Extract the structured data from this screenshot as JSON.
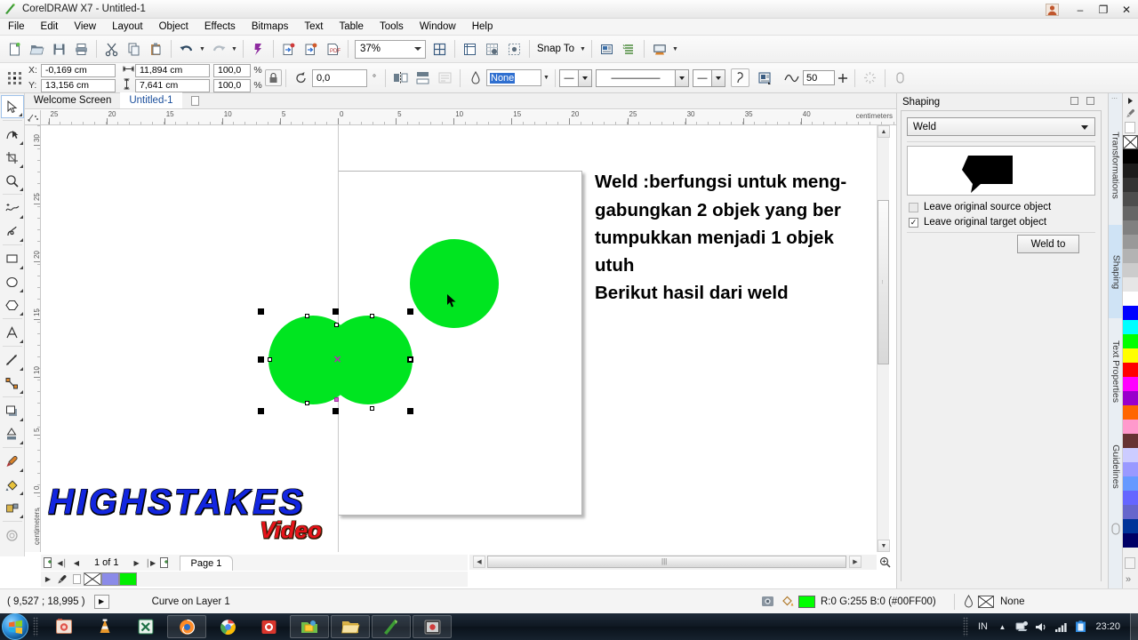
{
  "window": {
    "title": "CorelDRAW X7 - Untitled-1",
    "app_icon": "coreldraw-icon",
    "minimize": "–",
    "maximize": "❐",
    "close": "✕"
  },
  "menubar": {
    "items": [
      {
        "label": "File"
      },
      {
        "label": "Edit"
      },
      {
        "label": "View"
      },
      {
        "label": "Layout"
      },
      {
        "label": "Object"
      },
      {
        "label": "Effects"
      },
      {
        "label": "Bitmaps"
      },
      {
        "label": "Text"
      },
      {
        "label": "Table"
      },
      {
        "label": "Tools"
      },
      {
        "label": "Window"
      },
      {
        "label": "Help"
      }
    ]
  },
  "standard_toolbar": {
    "buttons": [
      "new-document-icon",
      "open-document-icon",
      "save-icon",
      "print-icon",
      "cut-icon",
      "copy-icon",
      "paste-icon",
      "undo-icon",
      "redo-icon",
      "import-icon",
      "export-icon",
      "publish-pdf-icon",
      "corel-connect-icon"
    ],
    "zoom_level": "37%",
    "snap_to_label": "Snap To",
    "options_icon": "options-icon",
    "view_icons": [
      "full-screen-preview-icon",
      "show-hide-rulers-icon",
      "show-hide-grid-icon",
      "show-hide-guidelines-icon"
    ]
  },
  "property_bar": {
    "x_label": "X:",
    "x_value": "-0,169 cm",
    "y_label": "Y:",
    "y_value": "13,156 cm",
    "width_value": "11,894 cm",
    "height_value": "7,641 cm",
    "scale_h": "100,0",
    "scale_v": "100,0",
    "percent_sign": "%",
    "lock_ratio_icon": "lock-ratio-icon",
    "rotation_value": "0,0",
    "degree_sign": "°",
    "mirror_icons": [
      "mirror-horizontal-icon",
      "mirror-vertical-icon",
      "wrap-paragraph-text-icon"
    ],
    "outline_width": "None",
    "outline_style_label": "",
    "arrow_start": "—",
    "line_style": "—————",
    "arrow_end": "—",
    "outline_pen_icon": "outline-pen-icon",
    "text_wrap_icon": "text-wrap-icon",
    "corner_smooth_icon": "corner-smooth-icon",
    "corner_value": "50",
    "edit_icon": "edit-bitmap-icon",
    "group_icon": "convert-outline-icon"
  },
  "doc_tabs": {
    "items": [
      {
        "label": "Welcome Screen",
        "active": false
      },
      {
        "label": "Untitled-1",
        "active": true
      }
    ],
    "new_tab_icon": "new-tab-icon"
  },
  "toolbox": {
    "tools": [
      {
        "name": "pick-tool",
        "selected": true
      },
      {
        "name": "shape-tool",
        "selected": false
      },
      {
        "name": "crop-tool",
        "selected": false
      },
      {
        "name": "zoom-tool",
        "selected": false
      },
      {
        "name": "freehand-tool",
        "selected": false
      },
      {
        "name": "smart-fill-tool",
        "selected": false
      },
      {
        "name": "rectangle-tool",
        "selected": false
      },
      {
        "name": "ellipse-tool",
        "selected": false
      },
      {
        "name": "polygon-tool",
        "selected": false
      },
      {
        "name": "text-tool",
        "selected": false
      },
      {
        "name": "parallel-dimension-tool",
        "selected": false
      },
      {
        "name": "straight-line-connector-tool",
        "selected": false
      },
      {
        "name": "drop-shadow-tool",
        "selected": false
      },
      {
        "name": "transparency-tool",
        "selected": false
      },
      {
        "name": "color-eyedropper-tool",
        "selected": false
      },
      {
        "name": "fill-tool",
        "selected": false
      },
      {
        "name": "interactive-fill-tool",
        "selected": false
      },
      {
        "name": "outline-tool",
        "selected": false
      }
    ]
  },
  "rulers": {
    "unit_label": "centimeters",
    "h_ticks": [
      "25",
      "20",
      "15",
      "10",
      "5",
      "0",
      "5",
      "10",
      "15",
      "20",
      "25",
      "30",
      "35",
      "40"
    ],
    "v_ticks": [
      "30",
      "25",
      "20",
      "15",
      "10",
      "5",
      "0"
    ]
  },
  "canvas": {
    "annotation_lines": [
      "Weld :berfungsi untuk meng-",
      "gabungkan 2 objek yang ber",
      "tumpukkan menjadi 1 objek",
      "utuh",
      "Berikut hasil dari weld"
    ],
    "shape_color": "#00e520",
    "shapes": [
      {
        "name": "welded-circles-object"
      },
      {
        "name": "source-circle-object"
      }
    ],
    "watermark_main": "HIGHSTAKES",
    "watermark_sub": "Video",
    "watermark_main_color": "#1226e0",
    "watermark_sub_color": "#e8131a"
  },
  "page_nav": {
    "add_page_start_icon": "add-page-icon",
    "first_icon": "◀│",
    "prev_icon": "◀",
    "page_counter": "1 of 1",
    "next_icon": "▶",
    "last_icon": "│▶",
    "add_page_end_icon": "add-page-icon",
    "page_tab": "Page 1"
  },
  "status_bar": {
    "coordinates": "( 9,527 ; 18,995 )",
    "object_info": "Curve on Layer 1",
    "fill_icon": "fill-color-icon",
    "fill_value": "R:0 G:255 B:0 (#00FF00)",
    "fill_swatch": "#00FF00",
    "outline_icon": "outline-color-icon",
    "outline_value": "None"
  },
  "docker": {
    "title": "Shaping",
    "minimize_icon": "docker-minimize-icon",
    "close_icon": "docker-close-icon",
    "operation": "Weld",
    "preview_icon": "weld-result-preview",
    "checkbox_source": {
      "label": "Leave original source object",
      "checked": false
    },
    "checkbox_target": {
      "label": "Leave original target object",
      "checked": true
    },
    "action_button": "Weld to",
    "tabs": [
      {
        "label": "Transformations",
        "selected": false,
        "icon": "transformations-icon"
      },
      {
        "label": "Shaping",
        "selected": true,
        "icon": "shaping-icon"
      },
      {
        "label": "Text Properties",
        "selected": false,
        "icon": "text-properties-icon"
      },
      {
        "label": "Guidelines",
        "selected": false,
        "icon": "guidelines-icon"
      },
      {
        "label": "",
        "selected": false,
        "icon": "object-properties-icon"
      }
    ]
  },
  "palette": {
    "no_color_label": "no-color-swatch",
    "colors": [
      "#000000",
      "#1c1c1c",
      "#333333",
      "#4d4d4d",
      "#666666",
      "#808080",
      "#999999",
      "#b3b3b3",
      "#cccccc",
      "#e6e6e6",
      "#ffffff",
      "#0000ff",
      "#00ffff",
      "#00ff00",
      "#ffff00",
      "#ff0000",
      "#ff00ff",
      "#9900cc",
      "#ff6600",
      "#ff99cc",
      "#663333",
      "#ccccff",
      "#9999ff",
      "#6699ff",
      "#6666ff",
      "#6666cc",
      "#003399",
      "#000066"
    ],
    "expand_icon": "»"
  },
  "taskbar": {
    "start_label": "start-orb",
    "items": [
      {
        "name": "taskbar-app-photo",
        "icon": "photo-icon"
      },
      {
        "name": "taskbar-app-vlc",
        "icon": "vlc-cone-icon"
      },
      {
        "name": "taskbar-app-excel",
        "icon": "excel-icon"
      },
      {
        "name": "taskbar-app-firefox",
        "icon": "firefox-icon"
      },
      {
        "name": "taskbar-app-chrome",
        "icon": "chrome-icon"
      },
      {
        "name": "taskbar-app-recorder",
        "icon": "record-icon"
      },
      {
        "name": "taskbar-app-folder-share",
        "icon": "folder-share-icon"
      },
      {
        "name": "taskbar-app-explorer",
        "icon": "explorer-icon"
      },
      {
        "name": "taskbar-app-coreldraw",
        "icon": "coreldraw-icon"
      },
      {
        "name": "taskbar-app-media",
        "icon": "media-icon"
      }
    ],
    "tray": {
      "language": "IN",
      "show_hidden_icon": "▲",
      "network_icon": "network-icon",
      "volume_icon": "volume-icon",
      "signal_icon": "signal-icon",
      "battery_icon": "battery-icon",
      "clock": "23:20"
    }
  }
}
